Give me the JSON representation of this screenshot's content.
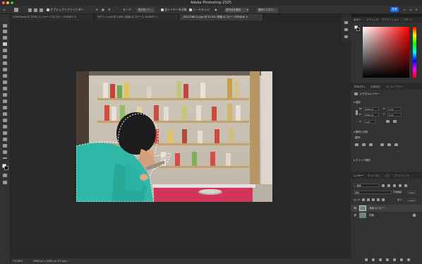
{
  "app": {
    "title": "Adobe Photoshop 2025"
  },
  "options_bar": {
    "tool_label": "オブジェクトファインダー",
    "mode_label": "モード:",
    "mode_value": "長方形ツー...",
    "all_layers_label": "全レイヤーを対象",
    "hard_edge_label": "ハードエッジ",
    "select_subject_label": "被写体を選択",
    "select_mask_label": "選択とマスク...",
    "share_label": "共有"
  },
  "doc_tabs": [
    {
      "label": "C05ctY.png @ 100% (レイヤー 1 のコピー, RGB/8*) ×"
    },
    {
      "label": "HR7イト.psd @ 248% (背景 のコピー 2, RGB/8*) ×"
    },
    {
      "label": "_DSC2186 (1).jpg @ 51.6% (背景 のコピー, RGB/8#) ×"
    }
  ],
  "status": {
    "zoom": "51.85%",
    "dimensions": "3984 px x 2560 px (72 ppi)"
  },
  "color_panel": {
    "tabs": [
      "カラー",
      "スウォッチ",
      "グラデーション",
      "パターン"
    ],
    "hue_color": "#ff0000"
  },
  "properties_panel": {
    "tabs": [
      "プロパティ",
      "色調補正",
      "CC ライブラリ"
    ],
    "layer_type": "ピクセルレイヤー",
    "transform_title": "変形",
    "w_label": "W",
    "w_value": "3984 px",
    "h_label": "H",
    "h_value": "2560 px",
    "x_label": "X",
    "x_value": "0 px",
    "y_label": "Y",
    "y_value": "0 px",
    "angle_value": "0.00°",
    "align_title": "整列と分布",
    "align_sub": "整列:",
    "quick_action_title": "クイック操作"
  },
  "layers_panel": {
    "tabs": [
      "レイヤー",
      "チャンネル",
      "パス",
      "グラフィック"
    ],
    "kind_label": "種類",
    "blend_mode": "通常",
    "opacity_label": "不透明度:",
    "opacity_value": "100%",
    "lock_label": "ロック:",
    "fill_label": "塗り:",
    "fill_value": "100%",
    "layers": [
      {
        "name": "背景 のコピー",
        "selected": true
      },
      {
        "name": "背景",
        "selected": false
      }
    ]
  }
}
